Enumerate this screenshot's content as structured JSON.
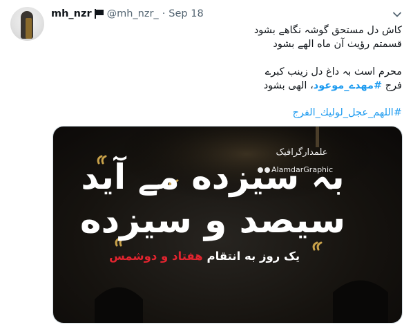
{
  "tweet": {
    "display_name": "mh_nzr",
    "handle": "@mh_nzr_",
    "separator": "·",
    "date": "Sep 18",
    "lines": [
      "کاش دل مستحق گوشہ نگاهے بشود",
      "قسمتم رؤیٺ آن ماه الهے بشود",
      "محرم اسٺ بہ داغ دل زینب کبرے"
    ],
    "line4": {
      "prefix": "فرج ",
      "hashtag": "#مهدے_موعود",
      "suffix": "، الهی بشود"
    },
    "hashtag_line": "#اللهم_عجل_لولیك_الفرج"
  },
  "card_image": {
    "brand_fa": "علمدارگرافیک",
    "brand_en": "AlamdarGraphic",
    "headline1": "بہ سیزده مے آید",
    "headline2": "سیصد و سیزده",
    "sub_white": "یک روز به انتقام",
    "sub_red": "هفتاد و دوشمس",
    "colors": {
      "red": "#e1242f",
      "gold": "#c9a24a",
      "background": "#16130f"
    }
  },
  "colors": {
    "link": "#1d9bf0",
    "muted": "#536471",
    "text": "#0f1419"
  },
  "icons": [
    "flag-icon",
    "chevron-down-icon",
    "profile-avatar"
  ]
}
